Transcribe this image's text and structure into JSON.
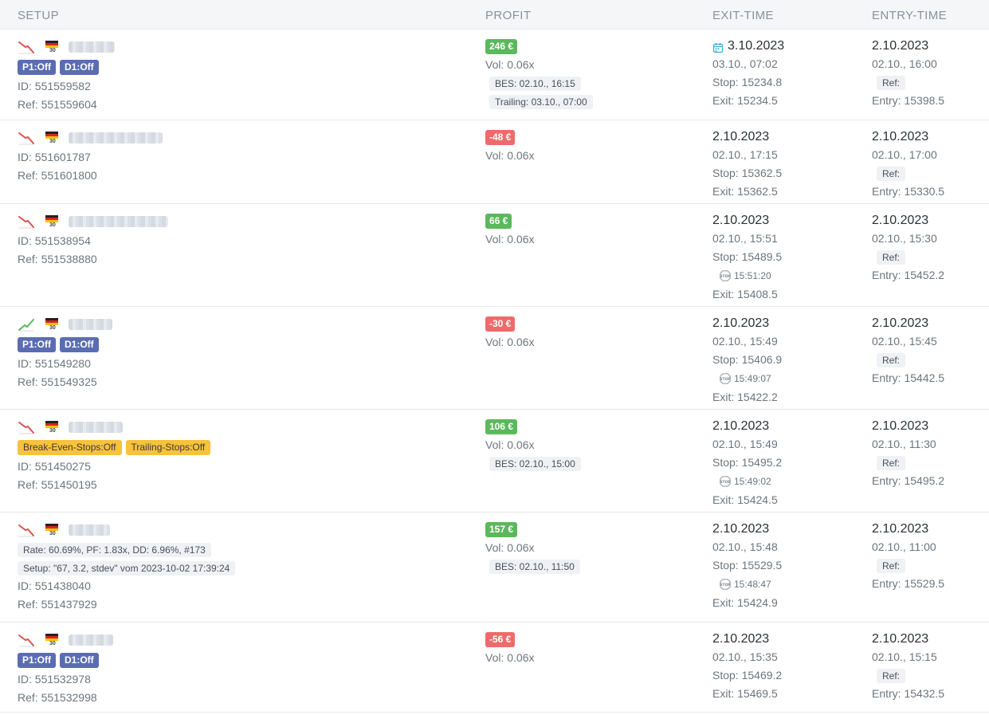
{
  "headers": {
    "setup": "SETUP",
    "profit": "PROFIT",
    "exit_time": "EXIT-TIME",
    "entry_time": "ENTRY-TIME"
  },
  "colors": {
    "positive": "#5cb85c",
    "negative": "#ee6b6b",
    "badge_blue": "#5a6db3",
    "badge_yellow": "#f7c23c",
    "trend_down": "#d9534f",
    "trend_up": "#5cb85c"
  },
  "rows": [
    {
      "trend": "down",
      "badges": [
        {
          "label": "P1:Off",
          "style": "blue"
        },
        {
          "label": "D1:Off",
          "style": "blue"
        }
      ],
      "id": "ID: 551559582",
      "ref": "Ref: 551559604",
      "profit": "246 €",
      "profit_sign": "positive",
      "vol": "Vol: 0.06x",
      "chips": [
        "BES: 02.10., 16:15",
        "Trailing: 03.10., 07:00"
      ],
      "exit_date": "3.10.2023",
      "exit_calendar": true,
      "exit_time": "03.10., 07:02",
      "stop": "Stop: 15234.8",
      "stop_time": "",
      "exit": "Exit: 15234.5",
      "entry_date": "2.10.2023",
      "entry_time": "02.10., 16:00",
      "ref_label": "Ref:",
      "entry": "Entry: 15398.5"
    },
    {
      "trend": "down",
      "badges": [],
      "id": "ID: 551601787",
      "ref": "Ref: 551601800",
      "profit": "-48 €",
      "profit_sign": "negative",
      "vol": "Vol: 0.06x",
      "chips": [],
      "exit_date": "2.10.2023",
      "exit_calendar": false,
      "exit_time": "02.10., 17:15",
      "stop": "Stop: 15362.5",
      "stop_time": "",
      "exit": "Exit: 15362.5",
      "entry_date": "2.10.2023",
      "entry_time": "02.10., 17:00",
      "ref_label": "Ref:",
      "entry": "Entry: 15330.5"
    },
    {
      "trend": "down",
      "badges": [],
      "id": "ID: 551538954",
      "ref": "Ref: 551538880",
      "profit": "66 €",
      "profit_sign": "positive",
      "vol": "Vol: 0.06x",
      "chips": [],
      "exit_date": "2.10.2023",
      "exit_calendar": false,
      "exit_time": "02.10., 15:51",
      "stop": "Stop: 15489.5",
      "stop_time": "15:51:20",
      "exit": "Exit: 15408.5",
      "entry_date": "2.10.2023",
      "entry_time": "02.10., 15:30",
      "ref_label": "Ref:",
      "entry": "Entry: 15452.2"
    },
    {
      "trend": "up",
      "badges": [
        {
          "label": "P1:Off",
          "style": "blue"
        },
        {
          "label": "D1:Off",
          "style": "blue"
        }
      ],
      "id": "ID: 551549280",
      "ref": "Ref: 551549325",
      "profit": "-30 €",
      "profit_sign": "negative",
      "vol": "Vol: 0.06x",
      "chips": [],
      "exit_date": "2.10.2023",
      "exit_calendar": false,
      "exit_time": "02.10., 15:49",
      "stop": "Stop: 15406.9",
      "stop_time": "15:49:07",
      "exit": "Exit: 15422.2",
      "entry_date": "2.10.2023",
      "entry_time": "02.10., 15:45",
      "ref_label": "Ref:",
      "entry": "Entry: 15442.5"
    },
    {
      "trend": "down",
      "badges": [
        {
          "label": "Break-Even-Stops:Off",
          "style": "yellow"
        },
        {
          "label": "Trailing-Stops:Off",
          "style": "yellow"
        }
      ],
      "id": "ID: 551450275",
      "ref": "Ref: 551450195",
      "profit": "106 €",
      "profit_sign": "positive",
      "vol": "Vol: 0.06x",
      "chips": [
        "BES: 02.10., 15:00"
      ],
      "exit_date": "2.10.2023",
      "exit_calendar": false,
      "exit_time": "02.10., 15:49",
      "stop": "Stop: 15495.2",
      "stop_time": "15:49:02",
      "exit": "Exit: 15424.5",
      "entry_date": "2.10.2023",
      "entry_time": "02.10., 11:30",
      "ref_label": "Ref:",
      "entry": "Entry: 15495.2"
    },
    {
      "trend": "down",
      "badges": [],
      "setup_chips": [
        "Rate: 60.69%, PF: 1.83x, DD: 6.96%, #173",
        "Setup: \"67, 3.2, stdev\" vom 2023-10-02 17:39:24"
      ],
      "id": "ID: 551438040",
      "ref": "Ref: 551437929",
      "profit": "157 €",
      "profit_sign": "positive",
      "vol": "Vol: 0.06x",
      "chips": [
        "BES: 02.10., 11:50"
      ],
      "exit_date": "2.10.2023",
      "exit_calendar": false,
      "exit_time": "02.10., 15:48",
      "stop": "Stop: 15529.5",
      "stop_time": "15:48:47",
      "exit": "Exit: 15424.9",
      "entry_date": "2.10.2023",
      "entry_time": "02.10., 11:00",
      "ref_label": "Ref:",
      "entry": "Entry: 15529.5"
    },
    {
      "trend": "down",
      "badges": [
        {
          "label": "P1:Off",
          "style": "blue"
        },
        {
          "label": "D1:Off",
          "style": "blue"
        }
      ],
      "id": "ID: 551532978",
      "ref": "Ref: 551532998",
      "profit": "-56 €",
      "profit_sign": "negative",
      "vol": "Vol: 0.06x",
      "chips": [],
      "exit_date": "2.10.2023",
      "exit_calendar": false,
      "exit_time": "02.10., 15:35",
      "stop": "Stop: 15469.2",
      "stop_time": "",
      "exit": "Exit: 15469.5",
      "entry_date": "2.10.2023",
      "entry_time": "02.10., 15:15",
      "ref_label": "Ref:",
      "entry": "Entry: 15432.5"
    }
  ]
}
